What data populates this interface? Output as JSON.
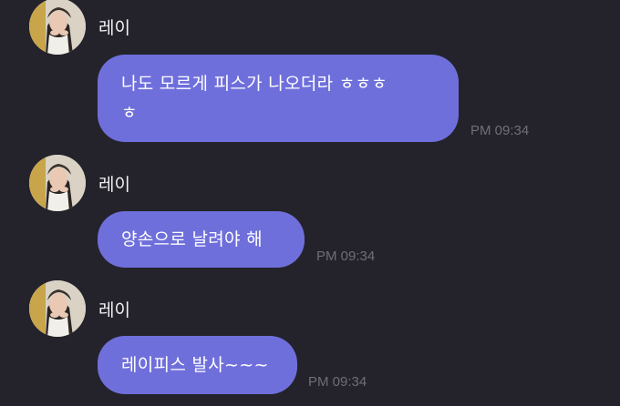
{
  "messages": [
    {
      "sender": "레이",
      "lines": [
        "나도 모르게 피스가 나오더라 ㅎㅎㅎ",
        "ㅎ"
      ],
      "time": "PM 09:34"
    },
    {
      "sender": "레이",
      "lines": [
        "양손으로 날려야 해"
      ],
      "time": "PM 09:34"
    },
    {
      "sender": "레이",
      "lines": [
        "레이피스 발사~~~"
      ],
      "time": "PM 09:34"
    }
  ],
  "colors": {
    "background": "#24232b",
    "bubble": "#6f6fdc",
    "sender_text": "#f2f2f4",
    "time_text": "#6f6e78"
  },
  "icons": {
    "avatar": "profile-photo"
  }
}
